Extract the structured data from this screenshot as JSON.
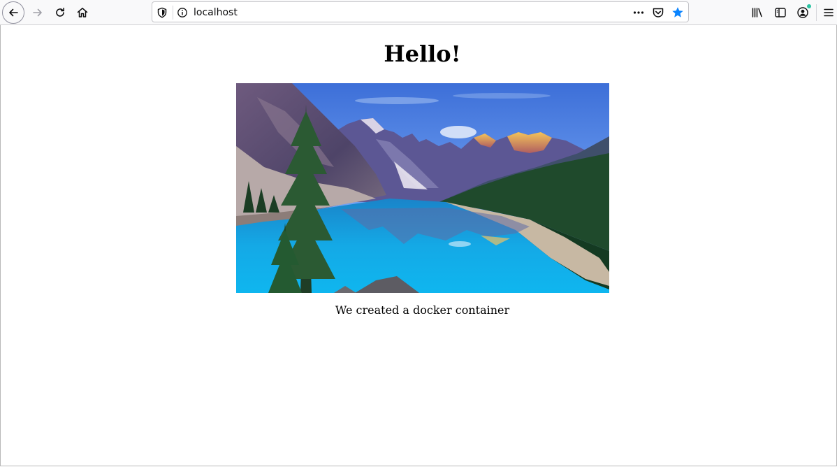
{
  "browser": {
    "url": "localhost",
    "icons": {
      "back": "back-arrow-icon",
      "forward": "forward-arrow-icon",
      "reload": "reload-icon",
      "home": "home-icon",
      "tracking": "shield-icon",
      "site_info": "info-icon",
      "page_actions": "more-dots-icon",
      "pocket": "pocket-icon",
      "bookmark": "star-icon",
      "library": "library-icon",
      "sidebar": "sidebar-icon",
      "account": "account-icon",
      "menu": "hamburger-menu-icon"
    },
    "colors": {
      "bookmark_star": "#0a84ff",
      "account_badge": "#2ac3a2"
    }
  },
  "page": {
    "heading": "Hello!",
    "image_subject": "mountain lake landscape",
    "caption": "We created a docker container"
  }
}
